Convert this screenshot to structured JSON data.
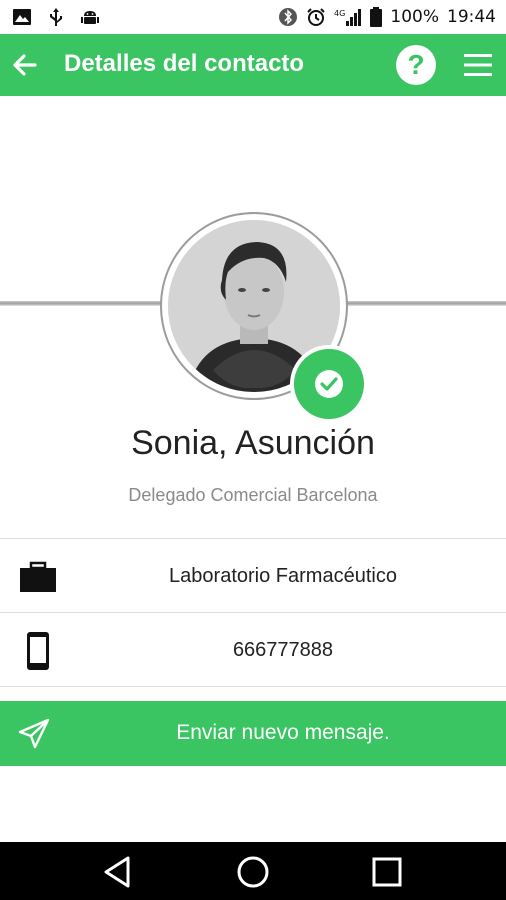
{
  "status_bar": {
    "battery": "100%",
    "time": "19:44",
    "network": "4G"
  },
  "app_bar": {
    "title": "Detalles del contacto",
    "help_label": "?"
  },
  "contact": {
    "name": "Sonia, Asunción",
    "role": "Delegado Comercial Barcelona",
    "company": "Laboratorio Farmacéutico",
    "phone": "666777888"
  },
  "actions": {
    "send_message_label": "Enviar nuevo mensaje."
  },
  "colors": {
    "accent": "#3ac462",
    "text": "#222222",
    "muted": "#8a8a8a"
  },
  "icons": {
    "back": "arrow-left-icon",
    "help": "help-icon",
    "menu": "hamburger-menu-icon",
    "verified": "check-icon",
    "company": "briefcase-icon",
    "phone": "smartphone-icon",
    "send": "paper-plane-icon",
    "nav_back": "triangle-back-icon",
    "nav_home": "circle-home-icon",
    "nav_recents": "square-recents-icon"
  }
}
